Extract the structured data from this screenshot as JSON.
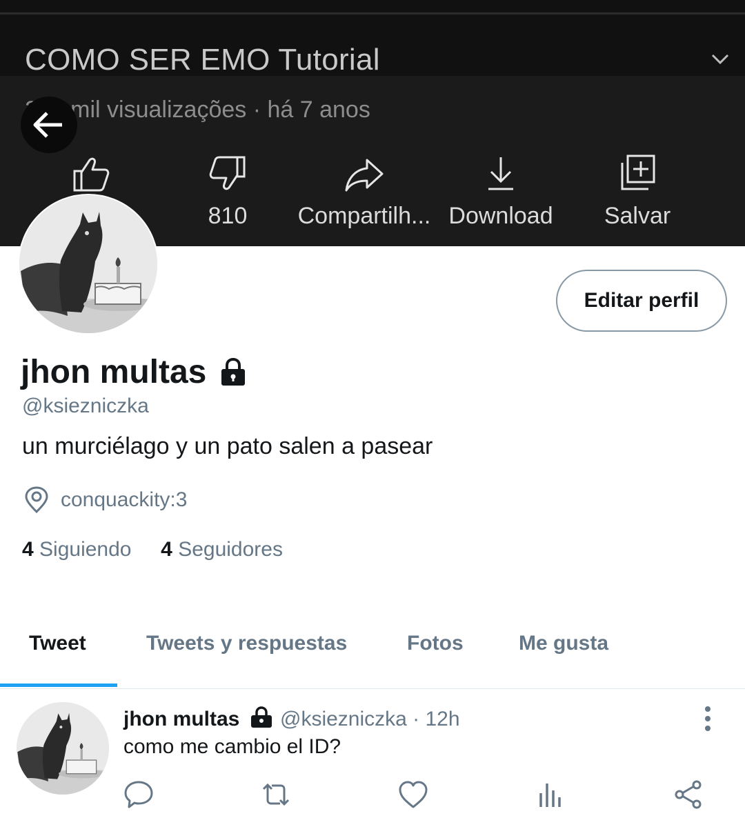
{
  "video": {
    "title": "COMO SER EMO Tutorial",
    "views_meta": "257 mil visualizações · há 7 anos",
    "actions": [
      {
        "icon": "thumbs-up-icon",
        "label": ""
      },
      {
        "icon": "thumbs-down-icon",
        "label": "810"
      },
      {
        "icon": "share-icon",
        "label": "Compartilh..."
      },
      {
        "icon": "download-icon",
        "label": "Download"
      },
      {
        "icon": "save-icon",
        "label": "Salvar"
      }
    ]
  },
  "profile": {
    "edit_button": "Editar perfil",
    "name": "jhon multas",
    "handle": "@ksiezniczka",
    "bio": "un murciélago y un pato salen a pasear",
    "location": "conquackity:3",
    "following_count": "4",
    "following_label": "Siguiendo",
    "followers_count": "4",
    "followers_label": "Seguidores"
  },
  "tabs": [
    {
      "label": "Tweet",
      "active": true
    },
    {
      "label": "Tweets y respuestas",
      "active": false
    },
    {
      "label": "Fotos",
      "active": false
    },
    {
      "label": "Me gusta",
      "active": false
    }
  ],
  "tweet": {
    "name": "jhon multas",
    "meta": "@ksiezniczka · 12h",
    "text": "como me cambio el ID?",
    "actions": [
      "reply-icon",
      "retweet-icon",
      "like-icon",
      "analytics-icon",
      "share-icon"
    ]
  },
  "colors": {
    "accent": "#1da1f2",
    "secondary_text": "#657786",
    "banner_bg": "#1b1b1b"
  }
}
